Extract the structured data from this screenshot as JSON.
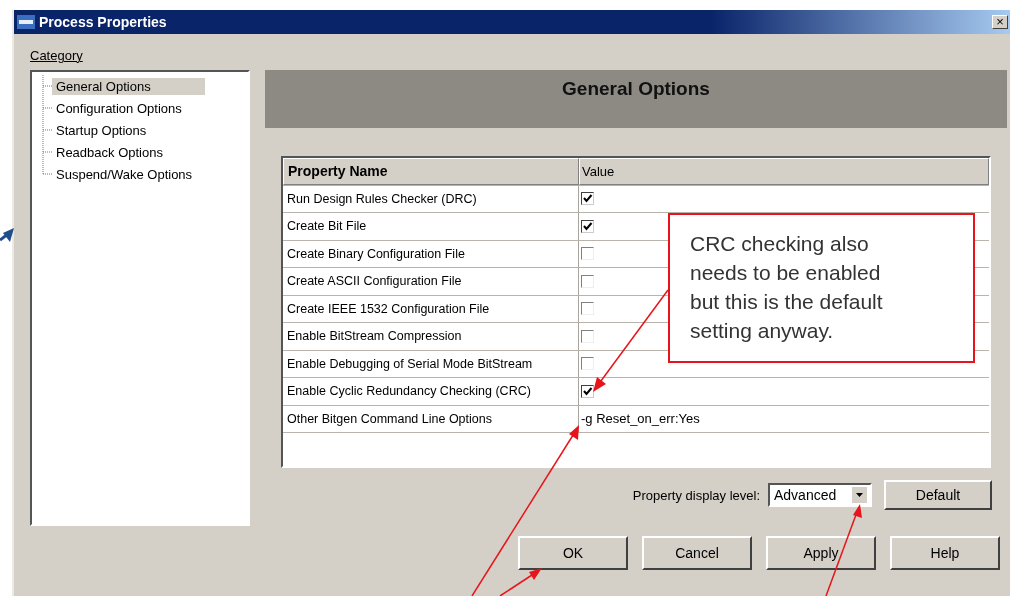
{
  "window": {
    "title": "Process Properties",
    "close": "×"
  },
  "category_label": "Category",
  "tree": {
    "items": [
      {
        "label": "General Options",
        "selected": true
      },
      {
        "label": "Configuration Options",
        "selected": false
      },
      {
        "label": "Startup Options",
        "selected": false
      },
      {
        "label": "Readback Options",
        "selected": false
      },
      {
        "label": "Suspend/Wake Options",
        "selected": false
      }
    ]
  },
  "panel_title": "General Options",
  "table": {
    "columns": [
      "Property Name",
      "Value"
    ],
    "rows": [
      {
        "name": "Run Design Rules Checker (DRC)",
        "kind": "checkbox",
        "checked": true
      },
      {
        "name": "Create Bit File",
        "kind": "checkbox",
        "checked": true
      },
      {
        "name": "Create Binary Configuration File",
        "kind": "checkbox",
        "checked": false
      },
      {
        "name": "Create ASCII Configuration File",
        "kind": "checkbox",
        "checked": false
      },
      {
        "name": "Create IEEE 1532 Configuration File",
        "kind": "checkbox",
        "checked": false
      },
      {
        "name": "Enable BitStream Compression",
        "kind": "checkbox",
        "checked": false
      },
      {
        "name": "Enable Debugging of Serial Mode BitStream",
        "kind": "checkbox",
        "checked": false
      },
      {
        "name": "Enable Cyclic Redundancy Checking (CRC)",
        "kind": "checkbox",
        "checked": true
      },
      {
        "name": "Other Bitgen Command Line Options",
        "kind": "text",
        "value": "-g Reset_on_err:Yes"
      }
    ]
  },
  "display_level": {
    "label": "Property display level:",
    "value": "Advanced"
  },
  "default_button": "Default",
  "buttons": [
    "OK",
    "Cancel",
    "Apply",
    "Help"
  ],
  "callout": "CRC checking also needs to be enabled but this is the default setting anyway."
}
